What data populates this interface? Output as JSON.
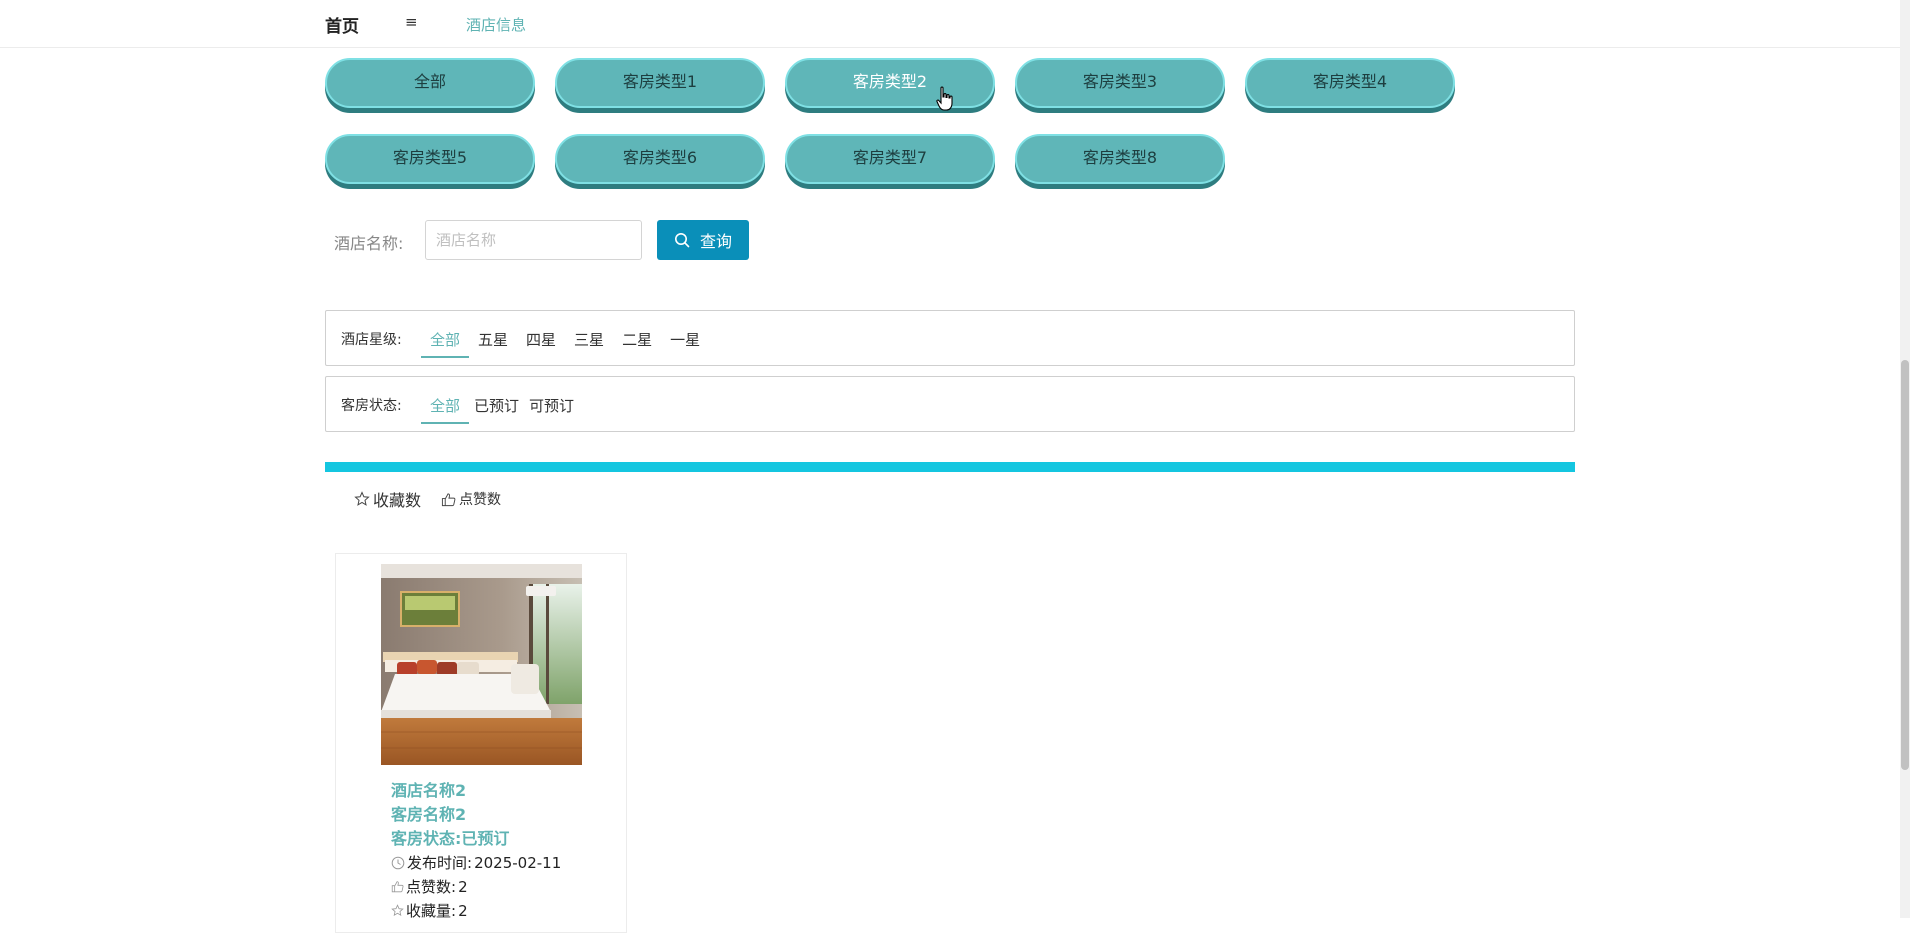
{
  "topbar": {
    "home": "首页",
    "menu_icon": "≡",
    "breadcrumb": "酒店信息"
  },
  "categories": [
    {
      "label": "全部",
      "active": false
    },
    {
      "label": "客房类型1",
      "active": false
    },
    {
      "label": "客房类型2",
      "active": true
    },
    {
      "label": "客房类型3",
      "active": false
    },
    {
      "label": "客房类型4",
      "active": false
    },
    {
      "label": "客房类型5",
      "active": false
    },
    {
      "label": "客房类型6",
      "active": false
    },
    {
      "label": "客房类型7",
      "active": false
    },
    {
      "label": "客房类型8",
      "active": false
    }
  ],
  "search": {
    "label": "酒店名称:",
    "placeholder": "酒店名称",
    "value": "",
    "button": "查询"
  },
  "filters": {
    "star": {
      "label": "酒店星级:",
      "options": [
        "全部",
        "五星",
        "四星",
        "三星",
        "二星",
        "一星"
      ],
      "selected": "全部"
    },
    "status": {
      "label": "客房状态:",
      "options": [
        "全部",
        "已预订",
        "可预订"
      ],
      "selected": "全部"
    }
  },
  "sort": {
    "favorites": "收藏数",
    "likes": "点赞数"
  },
  "card": {
    "hotel_name": "酒店名称2",
    "room_name": "客房名称2",
    "room_status": "客房状态:已预订",
    "publish_label": "发布时间:",
    "publish_date": "2025-02-11",
    "likes_label": "点赞数:",
    "likes": "2",
    "favorites_label": "收藏量:",
    "favorites": "2"
  },
  "colors": {
    "accent": "#5fb3b3",
    "pill": "#5fb6b8",
    "search_button": "#0a8fb9",
    "divider_bar": "#14c6e0"
  }
}
